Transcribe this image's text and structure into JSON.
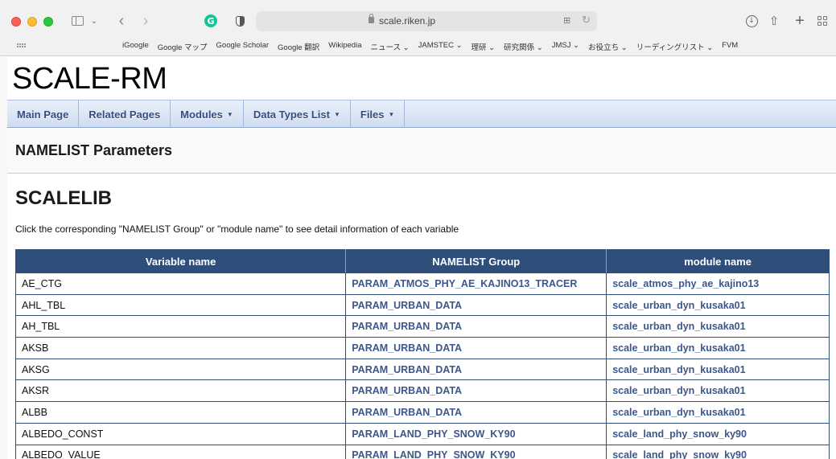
{
  "browser": {
    "url": "scale.riken.jp",
    "bookmarks": [
      "iGoogle",
      "Google マップ",
      "Google Scholar",
      "Google 翻訳",
      "Wikipedia",
      "ニュース ⌄",
      "JAMSTEC ⌄",
      "理研 ⌄",
      "研究関係 ⌄",
      "JMSJ ⌄",
      "お役立ち ⌄",
      "リーディングリスト ⌄",
      "FVM"
    ]
  },
  "project_name": "SCALE-RM",
  "navbar": {
    "items": [
      {
        "label": "Main Page"
      },
      {
        "label": "Related Pages"
      },
      {
        "label": "Modules",
        "arrow": "▼"
      },
      {
        "label": "Data Types List",
        "arrow": "▼"
      },
      {
        "label": "Files",
        "arrow": "▼"
      }
    ]
  },
  "header_title": "NAMELIST Parameters",
  "section_title": "SCALELIB",
  "intro_text": "Click the corresponding \"NAMELIST Group\" or \"module name\" to see detail information of each variable",
  "table": {
    "headers": [
      "Variable name",
      "NAMELIST Group",
      "module name"
    ],
    "rows": [
      [
        "AE_CTG",
        "PARAM_ATMOS_PHY_AE_KAJINO13_TRACER",
        "scale_atmos_phy_ae_kajino13"
      ],
      [
        "AHL_TBL",
        "PARAM_URBAN_DATA",
        "scale_urban_dyn_kusaka01"
      ],
      [
        "AH_TBL",
        "PARAM_URBAN_DATA",
        "scale_urban_dyn_kusaka01"
      ],
      [
        "AKSB",
        "PARAM_URBAN_DATA",
        "scale_urban_dyn_kusaka01"
      ],
      [
        "AKSG",
        "PARAM_URBAN_DATA",
        "scale_urban_dyn_kusaka01"
      ],
      [
        "AKSR",
        "PARAM_URBAN_DATA",
        "scale_urban_dyn_kusaka01"
      ],
      [
        "ALBB",
        "PARAM_URBAN_DATA",
        "scale_urban_dyn_kusaka01"
      ],
      [
        "ALBEDO_CONST",
        "PARAM_LAND_PHY_SNOW_KY90",
        "scale_land_phy_snow_ky90"
      ],
      [
        "ALBEDO_VALUE",
        "PARAM_LAND_PHY_SNOW_KY90",
        "scale_land_phy_snow_ky90"
      ]
    ]
  }
}
